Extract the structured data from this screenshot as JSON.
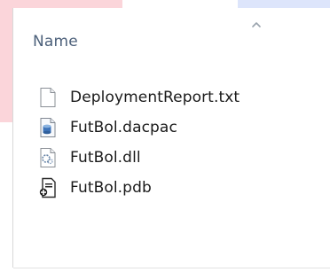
{
  "header": {
    "name_column_label": "Name",
    "sort_icon": "sort-ascending-icon"
  },
  "files": [
    {
      "name": "DeploymentReport.txt",
      "icon": "text-file-icon"
    },
    {
      "name": "FutBol.dacpac",
      "icon": "dacpac-file-icon"
    },
    {
      "name": "FutBol.dll",
      "icon": "dll-file-icon"
    },
    {
      "name": "FutBol.pdb",
      "icon": "pdb-file-icon"
    }
  ]
}
